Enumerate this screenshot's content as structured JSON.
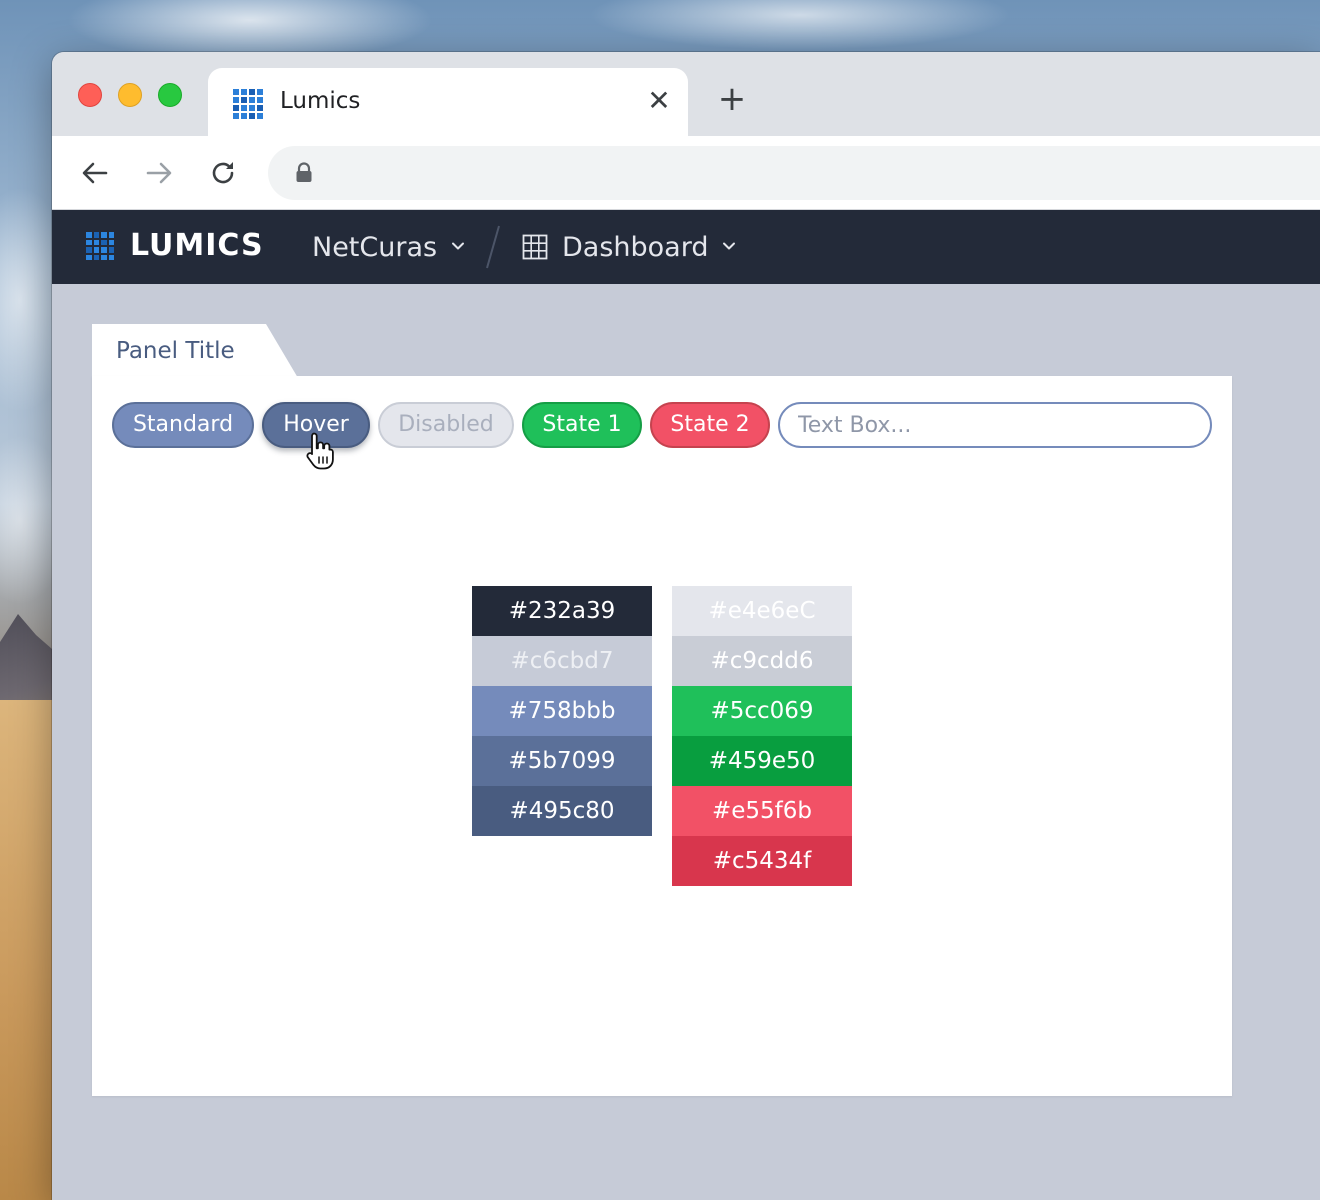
{
  "browser": {
    "tab_title": "Lumics",
    "tab_close_glyph": "✕",
    "new_tab_glyph": "+"
  },
  "app": {
    "logo_text": "LUMICS",
    "breadcrumb": {
      "org": "NetCuras",
      "page": "Dashboard"
    }
  },
  "panel": {
    "title": "Panel Title",
    "buttons": {
      "standard": "Standard",
      "hover": "Hover",
      "disabled": "Disabled",
      "state1": "State 1",
      "state2": "State 2"
    },
    "textbox_placeholder": "Text Box..."
  },
  "palette": {
    "left": [
      {
        "label": "#232a39",
        "color": "#232a39",
        "text": "#ffffff"
      },
      {
        "label": "#c6cbd7",
        "color": "#c6cbd7",
        "text": "#eef0f4"
      },
      {
        "label": "#758bbb",
        "color": "#758bbb",
        "text": "#ffffff"
      },
      {
        "label": "#5b7099",
        "color": "#5b7099",
        "text": "#ffffff"
      },
      {
        "label": "#495c80",
        "color": "#495c80",
        "text": "#ffffff"
      }
    ],
    "right": [
      {
        "label": "#e4e6eC",
        "color": "#e4e6ec",
        "text": "#ffffff"
      },
      {
        "label": "#c9cdd6",
        "color": "#c9cdd6",
        "text": "#ffffff"
      },
      {
        "label": "#5cc069",
        "color": "#1fc05a",
        "text": "#ffffff"
      },
      {
        "label": "#459e50",
        "color": "#089e3f",
        "text": "#ffffff"
      },
      {
        "label": "#e55f6b",
        "color": "#f25166",
        "text": "#ffffff"
      },
      {
        "label": "#c5434f",
        "color": "#d8364d",
        "text": "#ffffff"
      }
    ]
  },
  "colors": {
    "app_header": "#232a39",
    "page_background": "#c6cbd7",
    "accent": "#758bbb"
  },
  "icons": {
    "tab_favicon": "lumics-grid-icon",
    "back": "arrow-left-icon",
    "forward": "arrow-right-icon",
    "reload": "reload-icon",
    "lock": "lock-icon",
    "breadcrumb_page": "grid-icon",
    "chevron": "chevron-down-icon",
    "pointer": "hand-pointer-icon"
  }
}
